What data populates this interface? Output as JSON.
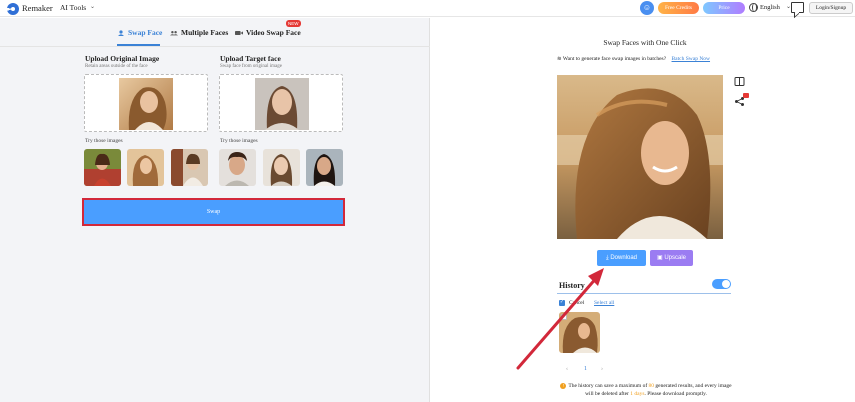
{
  "header": {
    "brand": "Remaker",
    "ai_tools": "AI Tools",
    "free_credits": "Free Credits",
    "price": "Price",
    "language": "English",
    "login": "Login/Signup"
  },
  "tabs": [
    {
      "label": "Swap Face",
      "icon": "face-icon",
      "active": true
    },
    {
      "label": "Multiple Faces",
      "icon": "users-icon",
      "active": false
    },
    {
      "label": "Video Swap Face",
      "icon": "video-icon",
      "active": false,
      "badge": "NEW"
    }
  ],
  "upload": {
    "original": {
      "title": "Upload Original Image",
      "subtitle": "Retain areas outside of the face"
    },
    "target": {
      "title": "Upload Target face",
      "subtitle": "Swap face from original image"
    },
    "try_label": "Try those images"
  },
  "swap_button": "Swap",
  "result": {
    "title": "Swap Faces with One Click",
    "batch_prompt": "Want to generate face swap images in batches?",
    "batch_link": "Batch Swap Now",
    "download": "Download",
    "upscale": "Upscale"
  },
  "history": {
    "title": "History",
    "cancel": "Cancel",
    "select_all": "Select all",
    "page": "1",
    "prev": "‹",
    "next": "›",
    "note_prefix": "The history can save a maximum of",
    "note_count": "80",
    "note_middle": "generated results, and every image will be deleted after",
    "note_days": "1 days",
    "note_suffix": ". Please download promptly."
  },
  "colors": {
    "accent": "#4a9eff",
    "highlight_border": "#d2283a",
    "arrow": "#d2283a",
    "upscale": "#9b7cf2"
  }
}
